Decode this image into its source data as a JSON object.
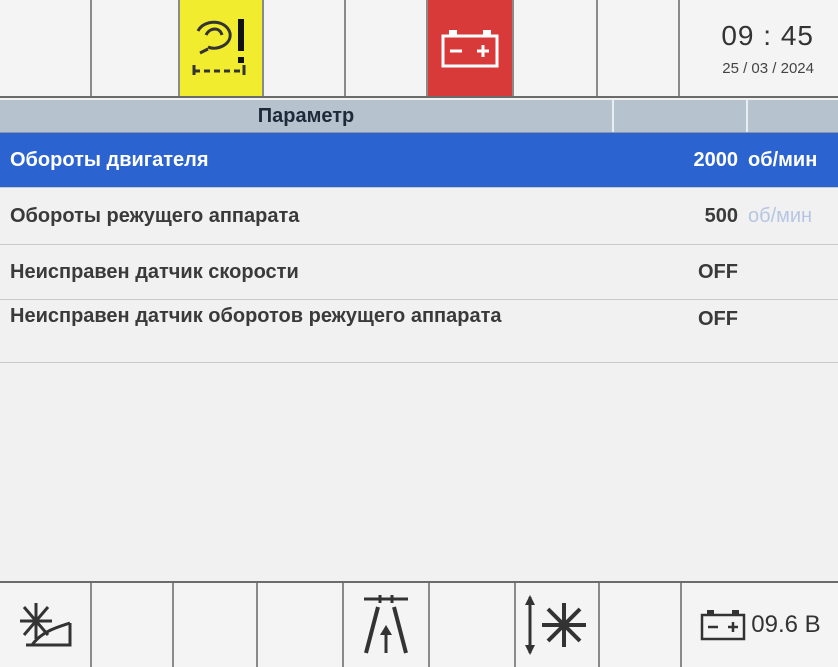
{
  "status_bar": {
    "time": "09 : 45",
    "date": "25 / 03 / 2024"
  },
  "table": {
    "header": "Параметр",
    "rows": [
      {
        "name": "Обороты двигателя",
        "value": "2000",
        "unit": "об/мин"
      },
      {
        "name": "Обороты режущего аппарата",
        "value": "500",
        "unit": "об/мин"
      },
      {
        "name": "Неисправен датчик скорости",
        "value": "OFF",
        "unit": ""
      },
      {
        "name": "Неисправен датчик оборотов режущего аппарата",
        "value": "OFF",
        "unit": ""
      }
    ]
  },
  "bottom_bar": {
    "battery_voltage": "09.6 В"
  },
  "icons": {
    "top": [
      "empty",
      "empty",
      "oil-pressure-warning-icon",
      "empty",
      "battery-warning-icon",
      "empty",
      "empty"
    ],
    "bottom": [
      "fan-angle-icon",
      "empty",
      "empty",
      "empty",
      "header-lift-icon",
      "empty",
      "reel-up-down-icon",
      "empty",
      "battery-icon"
    ]
  },
  "colors": {
    "warning_yellow": "#f1ec2e",
    "battery_red": "#d83a3a",
    "selection_blue": "#2b63d1",
    "header_bg": "#b7c2cf"
  }
}
